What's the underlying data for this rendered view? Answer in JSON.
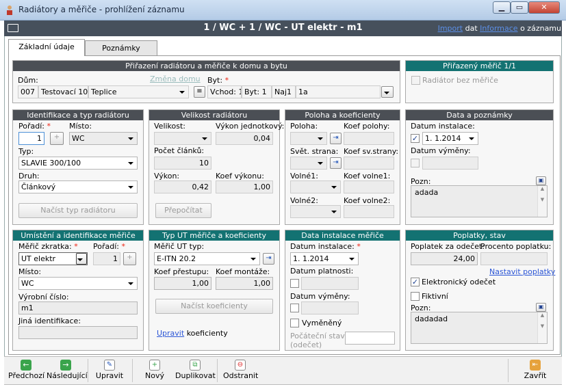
{
  "window": {
    "title": "Radiátory a měřiče - prohlížení záznamu",
    "min_glyph": "▁",
    "max_glyph": "▭",
    "close_glyph": "✕"
  },
  "header": {
    "title": "1 / WC + 1 / WC - UT elektr - m1",
    "import_link": "Import",
    "import_rest": "dat",
    "info_link": "Informace",
    "info_rest": "o záznamu"
  },
  "tabs": [
    {
      "label": "Základní údaje",
      "active": true
    },
    {
      "label": "Poznámky",
      "active": false
    }
  ],
  "assignment": {
    "title": "Přiřazení radiátoru a měřiče k domu a bytu",
    "house_label": "Dům:",
    "house_cells": [
      "007",
      "Testovací 10",
      "Teplice"
    ],
    "change_house": "Změna domu",
    "flat_label": "Byt:",
    "flat_cells": [
      "Vchod: 1",
      "Byt: 1",
      "Naj1",
      "1a"
    ]
  },
  "assigned_meter": {
    "title": "Přiřazený měřič  1/1",
    "no_meter_label": "Radiátor bez měřiče",
    "no_meter_checked": false
  },
  "identification": {
    "title": "Identifikace a typ radiátoru",
    "order_label": "Pořadí:",
    "order_value": "1",
    "place_label": "Místo:",
    "place_value": "WC",
    "type_label": "Typ:",
    "type_value": "SLAVIE 300/100",
    "kind_label": "Druh:",
    "kind_value": "Článkový",
    "load_type_button": "Načíst typ radiátoru"
  },
  "size": {
    "title": "Velikost radiátoru",
    "size_label": "Velikost:",
    "unit_power_label": "Výkon jednotkový:",
    "unit_power_value": "0,04",
    "sections_label": "Počet článků:",
    "sections_value": "10",
    "power_label": "Výkon:",
    "power_value": "0,42",
    "power_coef_label": "Koef výkonu:",
    "power_coef_value": "1,00",
    "recalc_button": "Přepočítat"
  },
  "position": {
    "title": "Poloha a koeficienty",
    "position_label": "Poloha:",
    "pos_coef_label": "Koef polohy:",
    "side_label": "Svět. strana:",
    "side_coef_label": "Koef sv.strany:",
    "free1_label": "Volné1:",
    "free1_coef_label": "Koef volne1:",
    "free2_label": "Volné2:",
    "free2_coef_label": "Koef volne2:"
  },
  "dates": {
    "title": "Data a poznámky",
    "install_label": "Datum instalace:",
    "install_value": "1.  1.2014",
    "install_checked": true,
    "replace_label": "Datum výměny:",
    "replace_checked": false,
    "note_label": "Pozn:",
    "note_value": "adada"
  },
  "meter_location": {
    "title": "Umístění a identifikace měřiče",
    "abbrev_label": "Měřič zkratka:",
    "abbrev_value": "UT elektr",
    "order_label": "Pořadí:",
    "order_value": "1",
    "place_label": "Místo:",
    "place_value": "WC",
    "serial_label": "Výrobní číslo:",
    "serial_value": "m1",
    "other_id_label": "Jiná identifikace:",
    "other_id_value": ""
  },
  "meter_type": {
    "title": "Typ UT měřiče a koeficienty",
    "type_label": "Měřič UT typ:",
    "type_value": "E-ITN 20.2",
    "transfer_label": "Koef přestupu:",
    "transfer_value": "1,00",
    "mount_label": "Koef montáže:",
    "mount_value": "1,00",
    "load_button": "Načíst koeficienty",
    "edit_link": "Upravit",
    "edit_rest": "koeficienty"
  },
  "meter_install": {
    "title": "Data instalace měřiče",
    "install_label": "Datum instalace:",
    "install_value": "1.  1.2014",
    "validity_label": "Datum platnosti:",
    "replace_label": "Datum výměny:",
    "replaced_label": "Vyměněný",
    "initial_state_label": "Počáteční stav:",
    "initial_state_sub": "(odečet)"
  },
  "fees": {
    "title": "Poplatky, stav",
    "fee_label": "Poplatek za odečet:",
    "fee_value": "24,00",
    "percent_label": "Procento poplatku:",
    "set_fees_link": "Nastavit poplatky",
    "electronic_label": "Elektronický odečet",
    "electronic_checked": true,
    "fictive_label": "Fiktivní",
    "fictive_checked": false,
    "note_label": "Pozn:",
    "note_value": "dadadad"
  },
  "toolbar": {
    "prev": "Předchozí",
    "next": "Následující",
    "edit": "Upravit",
    "new": "Nový",
    "duplicate": "Duplikovat",
    "delete": "Odstranit",
    "close": "Zavřít"
  },
  "colors": {
    "header_bg": "#46505c",
    "gray_panel": "#4b4f55",
    "teal_panel": "#137272",
    "link": "#2a55d6"
  }
}
